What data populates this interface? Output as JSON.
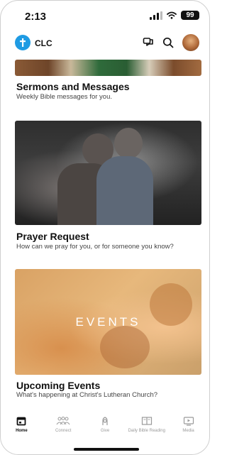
{
  "status": {
    "time": "2:13",
    "battery": "99"
  },
  "header": {
    "brand": "CLC"
  },
  "cards": [
    {
      "title": "Sermons and Messages",
      "subtitle": "Weekly Bible messages for you."
    },
    {
      "title": "Prayer Request",
      "subtitle": "How can we pray for you, or for someone you know?"
    },
    {
      "title": "Upcoming Events",
      "subtitle": "What's happening at Christ's Lutheran Church?",
      "image_text": "EVENTS"
    }
  ],
  "tabs": [
    {
      "label": "Home",
      "icon": "calendar-icon",
      "active": true
    },
    {
      "label": "Connect",
      "icon": "people-icon",
      "active": false
    },
    {
      "label": "Give",
      "icon": "give-icon",
      "active": false
    },
    {
      "label": "Daily Bible Reading",
      "icon": "book-icon",
      "active": false
    },
    {
      "label": "Media",
      "icon": "media-icon",
      "active": false
    }
  ],
  "colors": {
    "accent": "#1f9be3",
    "text": "#111111",
    "muted": "#9a9a9a"
  }
}
